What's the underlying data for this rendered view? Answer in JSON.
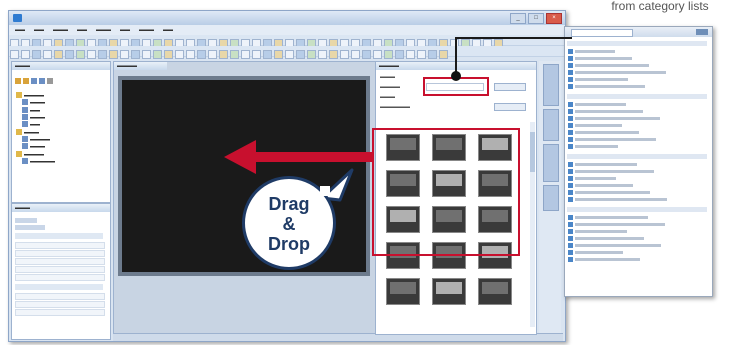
{
  "caption": {
    "visible_line": "from category lists"
  },
  "bubble": {
    "line1": "Drag",
    "line2": "&",
    "line3": "Drop"
  },
  "window": {
    "buttons": {
      "minimize": "_",
      "maximize": "□",
      "close": "×"
    }
  },
  "colors": {
    "accent_red": "#c8102e",
    "bubble_navy": "#1f3b66",
    "canvas_dark": "#1a1a1a",
    "window_chrome": "#d9e4f1"
  },
  "icons": [
    "app-icon",
    "folder-icon",
    "arrow-left-icon",
    "pointer-dot-icon",
    "scrollbar-thumb-icon"
  ]
}
